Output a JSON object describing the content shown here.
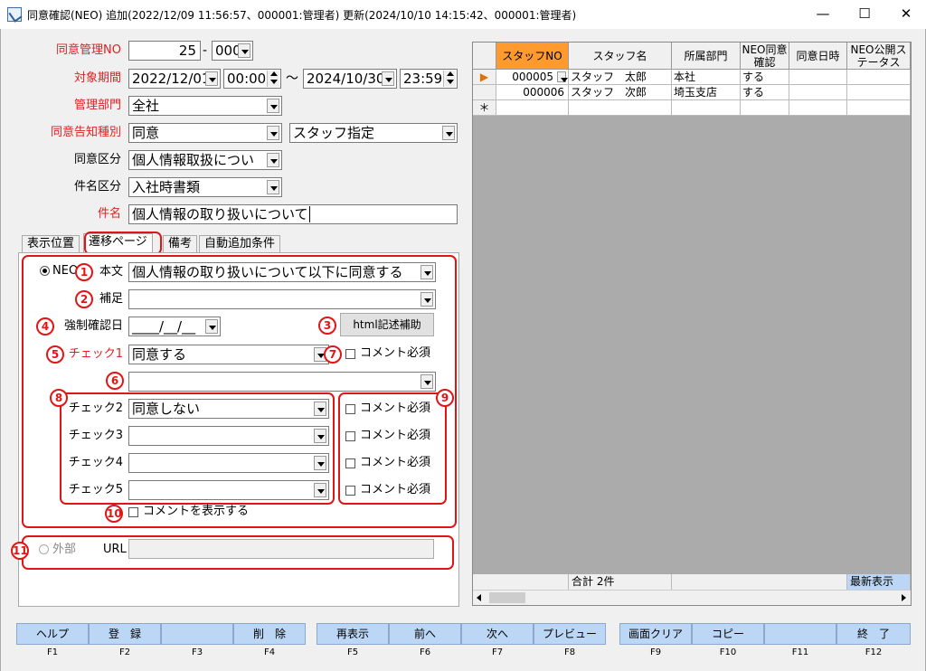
{
  "window": {
    "title": "同意確認(NEO) 追加(2022/12/09 11:56:57、000001:管理者) 更新(2024/10/10 14:15:42、000001:管理者)",
    "minimize": "—",
    "maximize": "☐",
    "close": "✕"
  },
  "form": {
    "mgmt_no_label": "同意管理NO",
    "mgmt_no_value": "25",
    "mgmt_no_sep": "-",
    "mgmt_no_sub": "000",
    "period_label": "対象期間",
    "period_from_date": "2022/12/01",
    "period_from_time": "00:00",
    "period_tilde": "〜",
    "period_to_date": "2024/10/30",
    "period_to_time": "23:59",
    "dept_label": "管理部門",
    "dept_value": "全社",
    "notice_label": "同意告知種別",
    "notice_value": "同意",
    "notice_target": "スタッフ指定",
    "category_label": "同意区分",
    "category_value": "個人情報取扱につい",
    "subject_cat_label": "件名区分",
    "subject_cat_value": "入社時書類",
    "subject_label": "件名",
    "subject_value": "個人情報の取り扱いについて"
  },
  "tabs": [
    "表示位置",
    "遷移ページ",
    "備考",
    "自動追加条件"
  ],
  "panel": {
    "neo_radio": "NEO",
    "body_label": "本文",
    "body_value": "個人情報の取り扱いについて以下に同意する",
    "supplement_label": "補足",
    "supplement_value": "",
    "forced_date_label": "強制確認日",
    "forced_date_value": "____/__/__",
    "html_button": "html記述補助",
    "check1_label": "チェック1",
    "check1_value": "同意する",
    "comment_required": "コメント必須",
    "check2_label": "チェック2",
    "check2_value": "同意しない",
    "check3_label": "チェック3",
    "check4_label": "チェック4",
    "check5_label": "チェック5",
    "show_comment": "コメントを表示する",
    "external_radio": "外部",
    "url_label": "URL",
    "url_value": ""
  },
  "badges": [
    "1",
    "2",
    "3",
    "4",
    "5",
    "6",
    "7",
    "8",
    "9",
    "10",
    "11"
  ],
  "grid": {
    "headers": [
      "スタッフNO",
      "スタッフ名",
      "所属部門",
      "NEO同意確認",
      "同意日時",
      "NEO公開ステータス"
    ],
    "rows": [
      {
        "no": "000005",
        "name": "スタッフ　太郎",
        "dept": "本社",
        "confirm": "する"
      },
      {
        "no": "000006",
        "name": "スタッフ　次郎",
        "dept": "埼玉支店",
        "confirm": "する"
      }
    ],
    "new_row_marker": "＊",
    "current_row_marker": "▶",
    "total": "合計 2件",
    "latest": "最新表示"
  },
  "fkeys": [
    {
      "label": "ヘルプ",
      "key": "F1"
    },
    {
      "label": "登　録",
      "key": "F2"
    },
    {
      "label": "",
      "key": "F3"
    },
    {
      "label": "削　除",
      "key": "F4"
    },
    {
      "label": "再表示",
      "key": "F5"
    },
    {
      "label": "前へ",
      "key": "F6"
    },
    {
      "label": "次へ",
      "key": "F7"
    },
    {
      "label": "プレビュー",
      "key": "F8"
    },
    {
      "label": "画面クリア",
      "key": "F9"
    },
    {
      "label": "コピー",
      "key": "F10"
    },
    {
      "label": "",
      "key": "F11"
    },
    {
      "label": "終　了",
      "key": "F12"
    }
  ],
  "colors": {
    "accent_red": "#e01515",
    "header_orange": "#ff9b2e",
    "fkey_blue": "#bcd7f5"
  }
}
